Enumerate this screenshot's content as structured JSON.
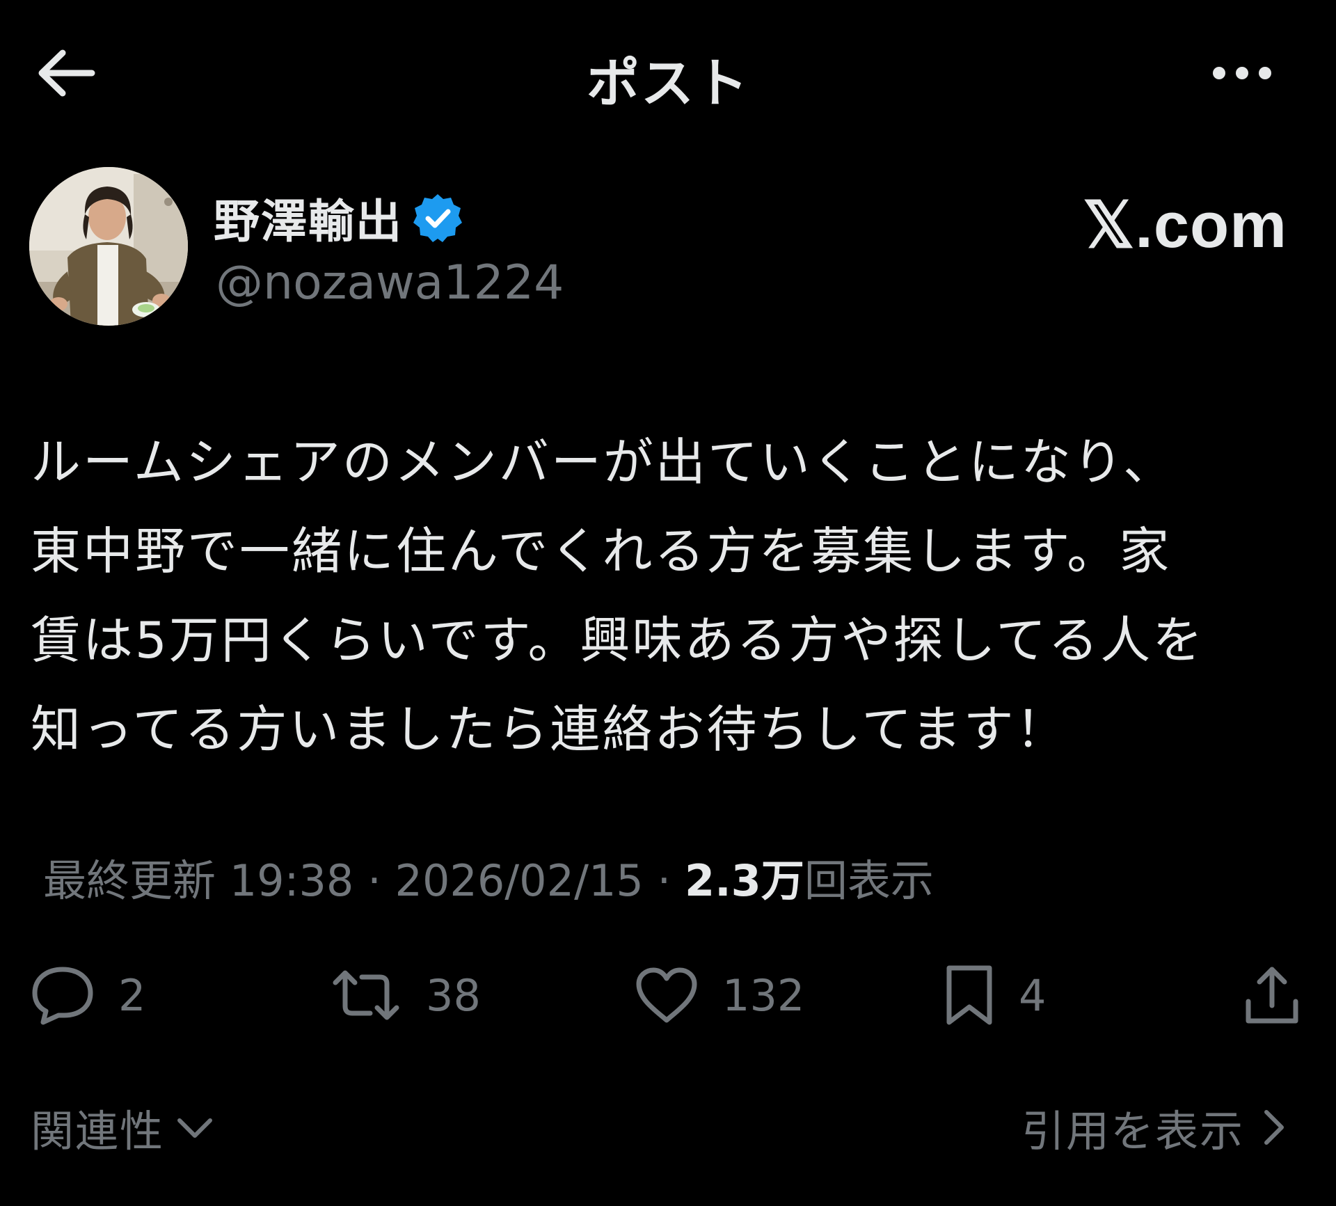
{
  "header": {
    "title": "ポスト",
    "back_icon": "arrow-left-icon",
    "more_icon": "more-dots-icon"
  },
  "author": {
    "display_name": "野澤輸出",
    "handle": "@nozawa1224",
    "verified": true,
    "verified_color": "#1d9bf0"
  },
  "watermark": "𝕏.com",
  "post": {
    "lines": [
      "ルームシェアのメンバーが出ていくことになり、",
      "東中野で一緒に住んでくれる方を募集します。家",
      "賃は5万円くらいです。興味ある方や探してる人を",
      "知ってる方いましたら連絡お待ちしてます！"
    ]
  },
  "meta": {
    "prefix": "最終更新 19:38 · 2026/02/15 · ",
    "views_count": "2.3万",
    "views_label": "回表示"
  },
  "actions": {
    "replies": "2",
    "reposts": "38",
    "likes": "132",
    "bookmarks": "4"
  },
  "footer": {
    "relevance_label": "関連性",
    "quotes_label": "引用を表示"
  },
  "colors": {
    "background": "#000000",
    "primary_text": "#e7e9ea",
    "secondary_text": "#71767b",
    "accent": "#1d9bf0"
  }
}
